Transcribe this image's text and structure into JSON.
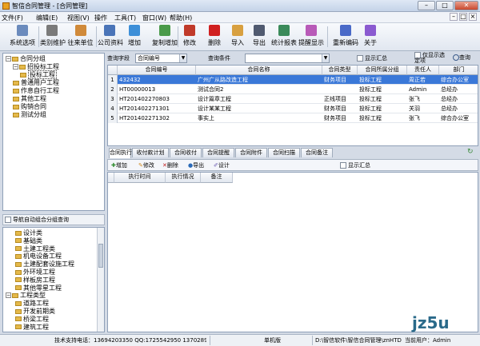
{
  "window": {
    "title": "智信合同管理 - [合同管理]",
    "minimize": "–",
    "maximize": "□",
    "close": "✕"
  },
  "menu": [
    "文件(F)",
    "编辑(E)",
    "视图(V)",
    "操作",
    "工具(T)",
    "窗口(W)",
    "帮助(H)"
  ],
  "toolbar": [
    {
      "label": "系统选项",
      "icon": "settings-icon",
      "color": "#6b8bbd"
    },
    {
      "label": "类别维护",
      "icon": "tools-icon",
      "color": "#7a7a7a"
    },
    {
      "label": "往来单位",
      "icon": "person-icon",
      "color": "#d08a3a"
    },
    {
      "label": "公司资料",
      "icon": "people-icon",
      "color": "#4a74b8"
    },
    {
      "label": "增加",
      "icon": "add-icon",
      "color": "#3d8fd8"
    },
    {
      "label": "复制增加",
      "icon": "copy-add-icon",
      "color": "#4a9a4a"
    },
    {
      "label": "修改",
      "icon": "edit-icon",
      "color": "#c03a2a"
    },
    {
      "label": "删除",
      "icon": "delete-icon",
      "color": "#d02020"
    },
    {
      "label": "导入",
      "icon": "import-icon",
      "color": "#d8a040"
    },
    {
      "label": "导出",
      "icon": "export-icon",
      "color": "#505a70"
    },
    {
      "label": "统计报表",
      "icon": "report-icon",
      "color": "#3a8a5a"
    },
    {
      "label": "提醒显示",
      "icon": "reminder-icon",
      "color": "#b85ab8"
    },
    {
      "label": "重新编码",
      "icon": "recode-icon",
      "color": "#4a6ac8"
    },
    {
      "label": "关于",
      "icon": "help-icon",
      "color": "#8a5ad0"
    }
  ],
  "tree_top": {
    "root": "合同分组",
    "items": [
      {
        "label": "招投标工程",
        "level": 1,
        "expand": "−"
      },
      {
        "label": "投标工程",
        "level": 2,
        "selected": true
      },
      {
        "label": "普通用户工程",
        "level": 1
      },
      {
        "label": "作息自行工程",
        "level": 1
      },
      {
        "label": "其他工程",
        "level": 1
      },
      {
        "label": "购销合同",
        "level": 1
      },
      {
        "label": "测试分组",
        "level": 1
      }
    ]
  },
  "nav_query_label": "导航自动组合分组查询",
  "tree_bottom": {
    "items": [
      {
        "label": "设计类",
        "level": 1
      },
      {
        "label": "基础类",
        "level": 1
      },
      {
        "label": "土建工程类",
        "level": 1
      },
      {
        "label": "机电设备工程",
        "level": 1
      },
      {
        "label": "土建配套设施工程",
        "level": 1
      },
      {
        "label": "外环境工程",
        "level": 1
      },
      {
        "label": "样板房工程",
        "level": 1
      },
      {
        "label": "其他零星工程",
        "level": 1
      },
      {
        "label": "工程类型",
        "level": 0,
        "expand": "−"
      },
      {
        "label": "道路工程",
        "level": 1
      },
      {
        "label": "开发前期类",
        "level": 1
      },
      {
        "label": "桥梁工程",
        "level": 1
      },
      {
        "label": "建筑工程",
        "level": 1
      }
    ]
  },
  "query": {
    "field_label": "查询字段",
    "field_value": "合同编号",
    "cond_label": "查询条件",
    "cond_value": "",
    "summary": "显示汇总",
    "only_selected": "仅显示选定项",
    "search": "查询"
  },
  "grid": {
    "headers": [
      "合同编号",
      "合同名称",
      "合同类型",
      "合同所属分组",
      "责任人",
      "部门"
    ],
    "rows": [
      {
        "no": "1",
        "cells": [
          "432432",
          "广州广从路改造工程",
          "财务项目",
          "投标工程",
          "周正若",
          "综合办公室"
        ],
        "selected": true
      },
      {
        "no": "2",
        "cells": [
          "HT00000013",
          "测试合同2",
          "",
          "投标工程",
          "Admin",
          "总经办"
        ]
      },
      {
        "no": "3",
        "cells": [
          "HT201402270803",
          "设计篇章工程",
          "正线项目",
          "投标工程",
          "张飞",
          "总经办"
        ]
      },
      {
        "no": "4",
        "cells": [
          "HT201402271301",
          "设计某某工程",
          "财务项目",
          "投标工程",
          "关羽",
          "总经办"
        ]
      },
      {
        "no": "5",
        "cells": [
          "HT201402271302",
          "事实上",
          "财务项目",
          "投标工程",
          "张飞",
          "综合办公室"
        ]
      }
    ]
  },
  "tabs": [
    "合同执行",
    "收付款计划",
    "合同收付",
    "合同提醒",
    "合同附件",
    "合同扫描",
    "合同备注"
  ],
  "subtoolbar": {
    "add": "增加",
    "edit": "修改",
    "delete": "删除",
    "export": "导出",
    "design": "设计",
    "summary": "显示汇总"
  },
  "subgrid": {
    "headers": [
      "执行时间",
      "执行情况",
      "备注"
    ]
  },
  "status": {
    "support": "技术支持电话：13694203350 QQ:1725542950 13702895",
    "mode": "单机版",
    "path": "D:\\智信软件\\智信合同管理\\znHTData.mdb",
    "user": "当前用户：Admin"
  },
  "watermark": "jz5u"
}
